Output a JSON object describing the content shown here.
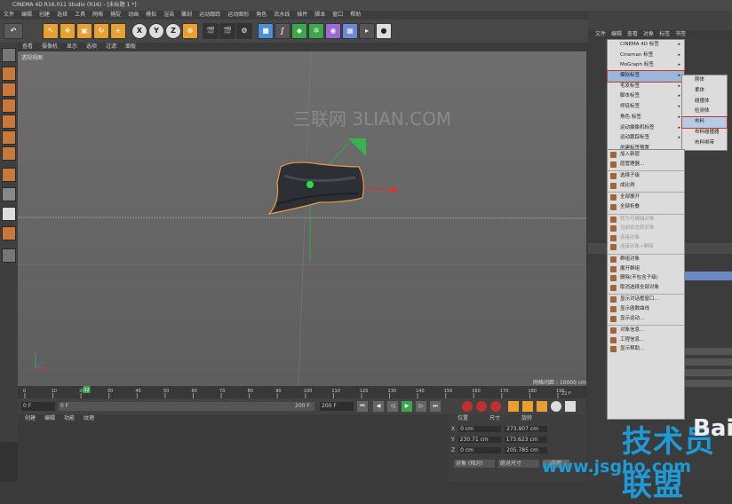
{
  "window": {
    "title": "CINEMA 4D R16.011 Studio (R16) - [未标题 1 *]"
  },
  "menubar": [
    "文件",
    "编辑",
    "创建",
    "选择",
    "工具",
    "网格",
    "捕捉",
    "动画",
    "模拟",
    "渲染",
    "雕刻",
    "运动跟踪",
    "运动图形",
    "角色",
    "流水线",
    "插件",
    "脚本",
    "窗口",
    "帮助"
  ],
  "toolbar": {
    "x": "X",
    "y": "Y",
    "z": "Z"
  },
  "viewport": {
    "menu": [
      "查看",
      "摄像机",
      "显示",
      "选项",
      "过滤",
      "面板"
    ],
    "label": "透视视图",
    "grid_info": "网格间距 : 10000 cm",
    "watermark": "三联网 3LIAN.COM"
  },
  "timeline": {
    "ticks": [
      "0",
      "10",
      "20",
      "30",
      "40",
      "50",
      "60",
      "70",
      "80",
      "90",
      "100",
      "110",
      "120",
      "130",
      "140",
      "150",
      "160",
      "170",
      "180",
      "190"
    ],
    "current": "22",
    "end_frame": "22 F"
  },
  "transport": {
    "start": "0 F",
    "field": "0 F",
    "end1": "200 F",
    "end2": "200 F"
  },
  "materials": {
    "menu": [
      "创建",
      "编辑",
      "功能",
      "纹理"
    ]
  },
  "coordinates": {
    "headers": [
      "位置",
      "尺寸",
      "旋转"
    ],
    "rows": [
      {
        "axis": "X",
        "pos": "0 cm",
        "size": "273.907 cm"
      },
      {
        "axis": "Y",
        "pos": "230.71 cm",
        "size": "173.623 cm"
      },
      {
        "axis": "Z",
        "pos": "0 cm",
        "size": "205.785 cm"
      }
    ],
    "mode": "对象 (相对)",
    "size_mode": "绝对尺寸",
    "apply": "应用"
  },
  "right_panel": {
    "menu": [
      "文件",
      "编辑",
      "查看",
      "对象",
      "标签",
      "书签"
    ]
  },
  "menu_tags": [
    "CINEMA 4D 标签",
    "Cineman 标签",
    "MoGraph 标签",
    "模拟标签",
    "毛发标签",
    "脚本标签",
    "师徒标签",
    "角色 标签",
    "运动摄像机标签",
    "运动跟踪标签",
    "创建标签预置",
    "恢复选集"
  ],
  "menu_sim": [
    "刚体",
    "柔体",
    "碰撞体",
    "检测体",
    "布料",
    "布料碰撞器",
    "布料绑带"
  ],
  "menu_obj": [
    "加入新层",
    "层管理器...",
    "选择子级",
    "成比例",
    "全部展开",
    "全部折叠",
    "转为可编辑对象",
    "当前状态转对象",
    "连接对象",
    "连接对象+删除",
    "群组对象",
    "展开群组",
    "删除(不包含子级)",
    "取消选择全部对象",
    "显示对话框窗口...",
    "显示函数曲线",
    "显示运动...",
    "对象信息...",
    "工程信息...",
    "显示帮助..."
  ],
  "watermarks": {
    "big": "技术员联盟",
    "url": "www.jsgho.com",
    "corner": "Bai"
  }
}
